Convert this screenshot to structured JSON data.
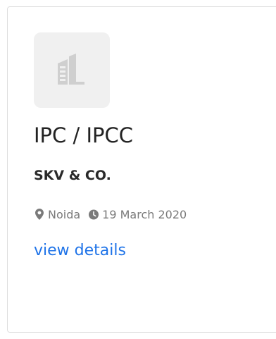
{
  "card": {
    "job_title": "IPC / IPCC",
    "company": "SKV & CO.",
    "location": "Noida",
    "date": "19 March 2020",
    "details_label": "view details"
  },
  "icons": {
    "logo": "building-icon",
    "location": "map-marker-icon",
    "date": "clock-icon"
  },
  "colors": {
    "link": "#1e73e8",
    "meta": "#7a7a7a",
    "logo_tile": "#f0f0f0"
  }
}
